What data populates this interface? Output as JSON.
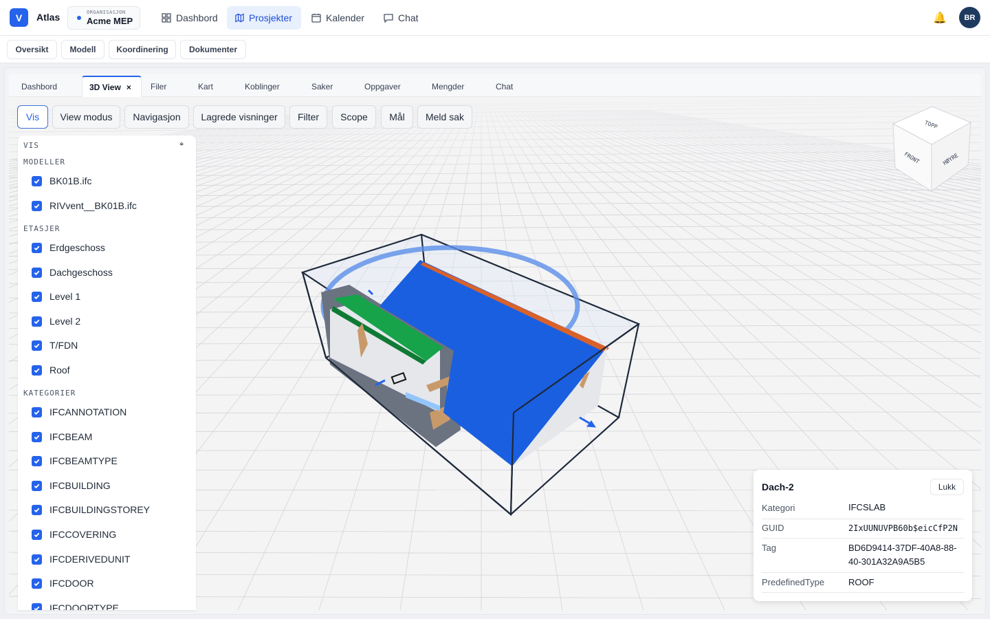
{
  "app": {
    "logo_letter": "V",
    "name": "Atlas"
  },
  "org": {
    "label": "ORGANISASJON",
    "value": "Acme MEP"
  },
  "nav": [
    {
      "label": "Dashbord",
      "icon": "dashboard-icon"
    },
    {
      "label": "Prosjekter",
      "icon": "projects-icon",
      "active": true
    },
    {
      "label": "Kalender",
      "icon": "calendar-icon"
    },
    {
      "label": "Chat",
      "icon": "chat-icon"
    }
  ],
  "user": {
    "initials": "BR"
  },
  "subnav": [
    "Oversikt",
    "Modell",
    "Koordinering",
    "Dokumenter"
  ],
  "tabs": [
    {
      "label": "Dashbord"
    },
    {
      "label": "3D View",
      "active": true,
      "close": "×"
    },
    {
      "label": "Filer"
    },
    {
      "label": "Kart"
    },
    {
      "label": "Koblinger"
    },
    {
      "label": "Saker"
    },
    {
      "label": "Oppgaver"
    },
    {
      "label": "Mengder"
    },
    {
      "label": "Chat"
    }
  ],
  "toolbar": [
    "Vis",
    "View modus",
    "Navigasjon",
    "Lagrede visninger",
    "Filter",
    "Scope",
    "Mål",
    "Meld sak"
  ],
  "panel": {
    "title": "VIS",
    "pin_icon": "⌖",
    "sections": [
      {
        "title": "MODELLER",
        "items": [
          "BK01B.ifc",
          "RIVvent__BK01B.ifc"
        ]
      },
      {
        "title": "ETASJER",
        "items": [
          "Erdgeschoss",
          "Dachgeschoss",
          "Level 1",
          "Level 2",
          "T/FDN",
          "Roof"
        ]
      },
      {
        "title": "KATEGORIER",
        "items": [
          "IFCANNOTATION",
          "IFCBEAM",
          "IFCBEAMTYPE",
          "IFCBUILDING",
          "IFCBUILDINGSTOREY",
          "IFCCOVERING",
          "IFCDERIVEDUNIT",
          "IFCDOOR",
          "IFCDOORTYPE"
        ]
      }
    ]
  },
  "navcube": {
    "top": "TOPP",
    "front": "FRONT",
    "right": "HØYRE"
  },
  "properties": {
    "title": "Dach-2",
    "close_label": "Lukk",
    "rows": [
      {
        "key": "Kategori",
        "value": "IFCSLAB"
      },
      {
        "key": "GUID",
        "value": "2IxUUNUVPB60b$eicCfP2N"
      },
      {
        "key": "Tag",
        "value": "BD6D9414-37DF-40A8-88-40-301A32A9A5B5"
      },
      {
        "key": "PredefinedType",
        "value": "ROOF"
      }
    ]
  },
  "colors": {
    "accent": "#2563eb",
    "selection": "#1a5fe0",
    "notification": "#f59e0b"
  }
}
